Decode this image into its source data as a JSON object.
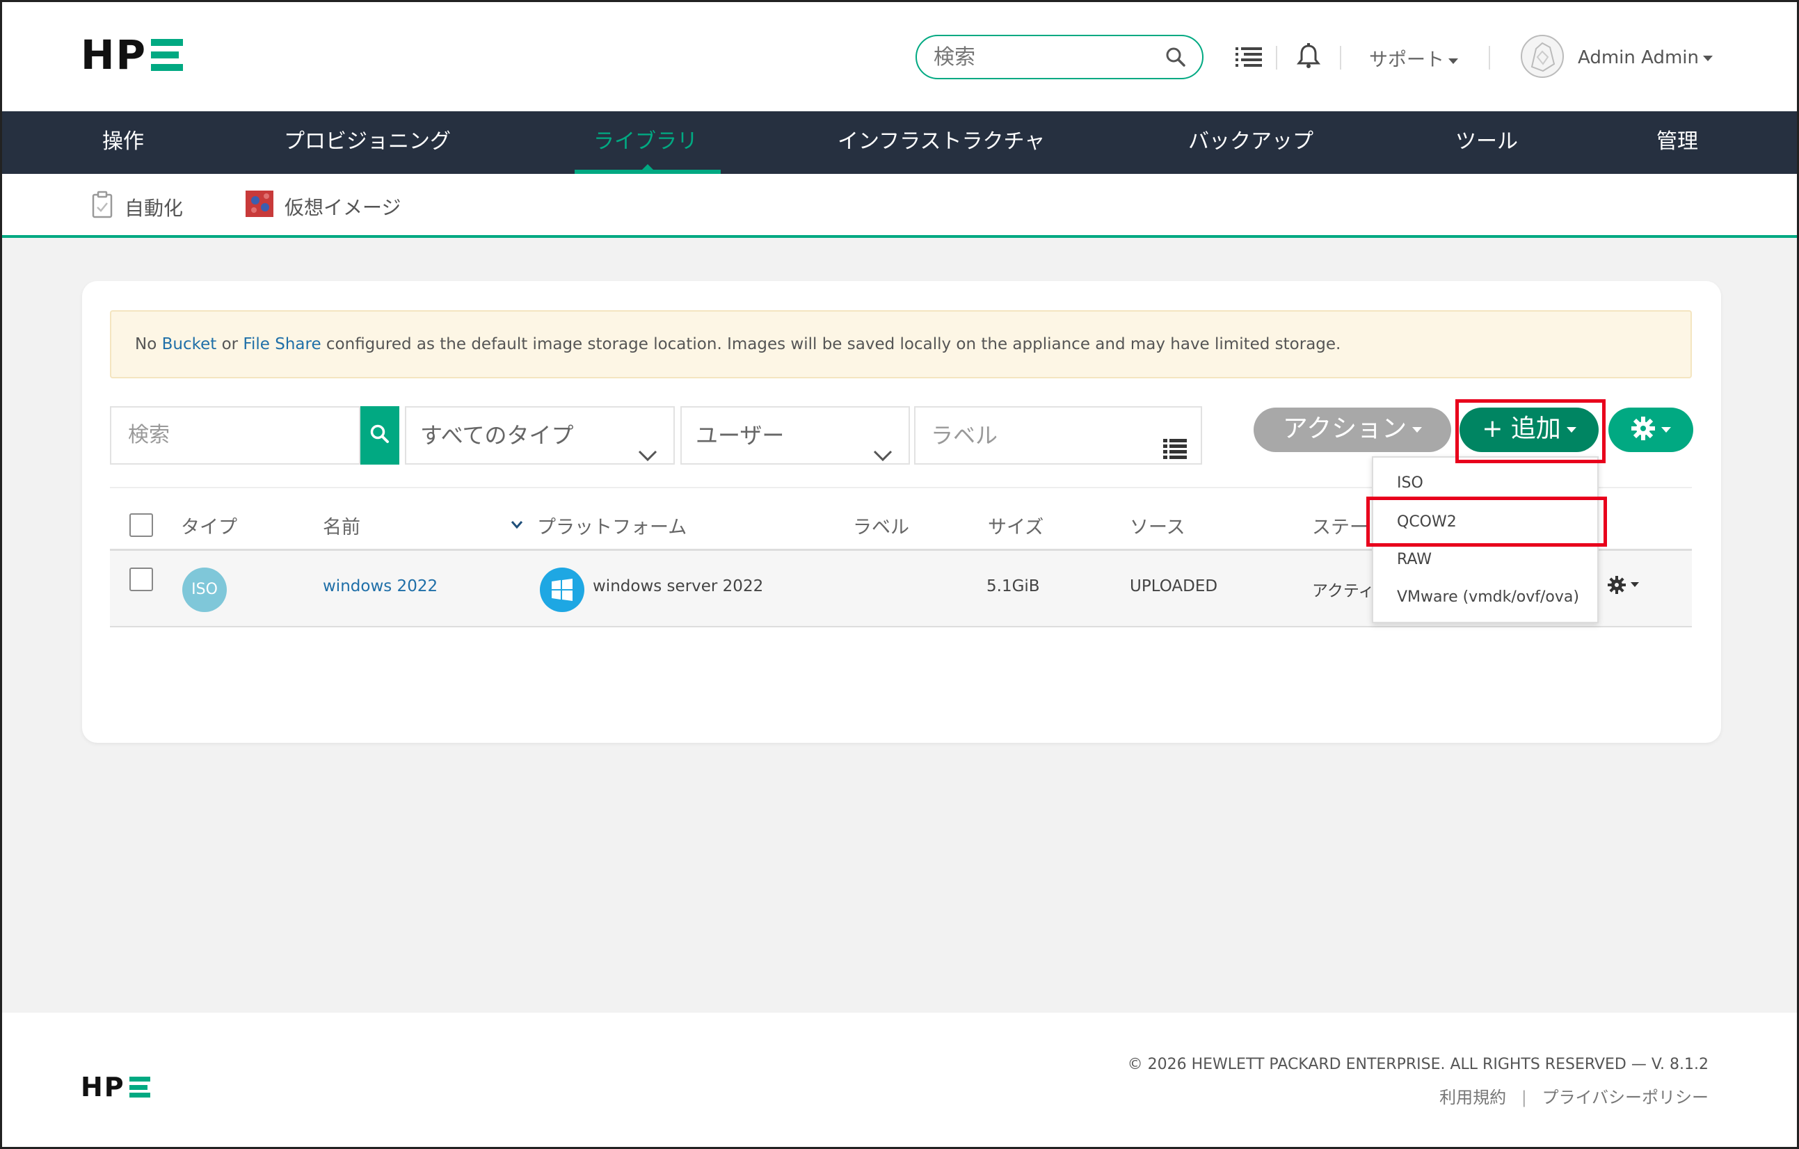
{
  "header": {
    "logo_text": "HP",
    "search_placeholder": "検索",
    "support_label": "サポート",
    "user_label": "Admin Admin"
  },
  "nav": {
    "items": [
      {
        "label": "操作"
      },
      {
        "label": "プロビジョニング"
      },
      {
        "label": "ライブラリ"
      },
      {
        "label": "インフラストラクチャ"
      },
      {
        "label": "バックアップ"
      },
      {
        "label": "ツール"
      },
      {
        "label": "管理"
      }
    ],
    "active_index": 2
  },
  "subnav": {
    "items": [
      {
        "label": "自動化"
      },
      {
        "label": "仮想イメージ"
      }
    ]
  },
  "alert": {
    "prefix": "No ",
    "link1": "Bucket",
    "mid": " or ",
    "link2": "File Share",
    "suffix": " configured as the default image storage location. Images will be saved locally on the appliance and may have limited storage."
  },
  "filters": {
    "search_placeholder": "検索",
    "type_select": "すべてのタイプ",
    "user_select": "ユーザー",
    "label_placeholder": "ラベル"
  },
  "buttons": {
    "actions": "アクション",
    "add": "+ 追加"
  },
  "table": {
    "columns": [
      "タイプ",
      "名前",
      "プラットフォーム",
      "ラベル",
      "サイズ",
      "ソース",
      "ステー"
    ],
    "rows": [
      {
        "type": "ISO",
        "name": "windows 2022",
        "platform": "windows server 2022",
        "label": "",
        "size": "5.1GiB",
        "source": "UPLOADED",
        "status": "アクティ"
      }
    ]
  },
  "add_menu": {
    "items": [
      "ISO",
      "QCOW2",
      "RAW",
      "VMware (vmdk/ovf/ova)"
    ]
  },
  "footer": {
    "logo_text": "HP",
    "copyright": "© 2026 HEWLETT PACKARD ENTERPRISE. ALL RIGHTS RESERVED  — V. 8.1.2",
    "terms": "利用規約",
    "separator": "|",
    "privacy": "プライバシーポリシー"
  },
  "colors": {
    "accent": "#01a982",
    "nav_bg": "#263040",
    "add_button": "#008562",
    "highlight": "#e8001c"
  }
}
